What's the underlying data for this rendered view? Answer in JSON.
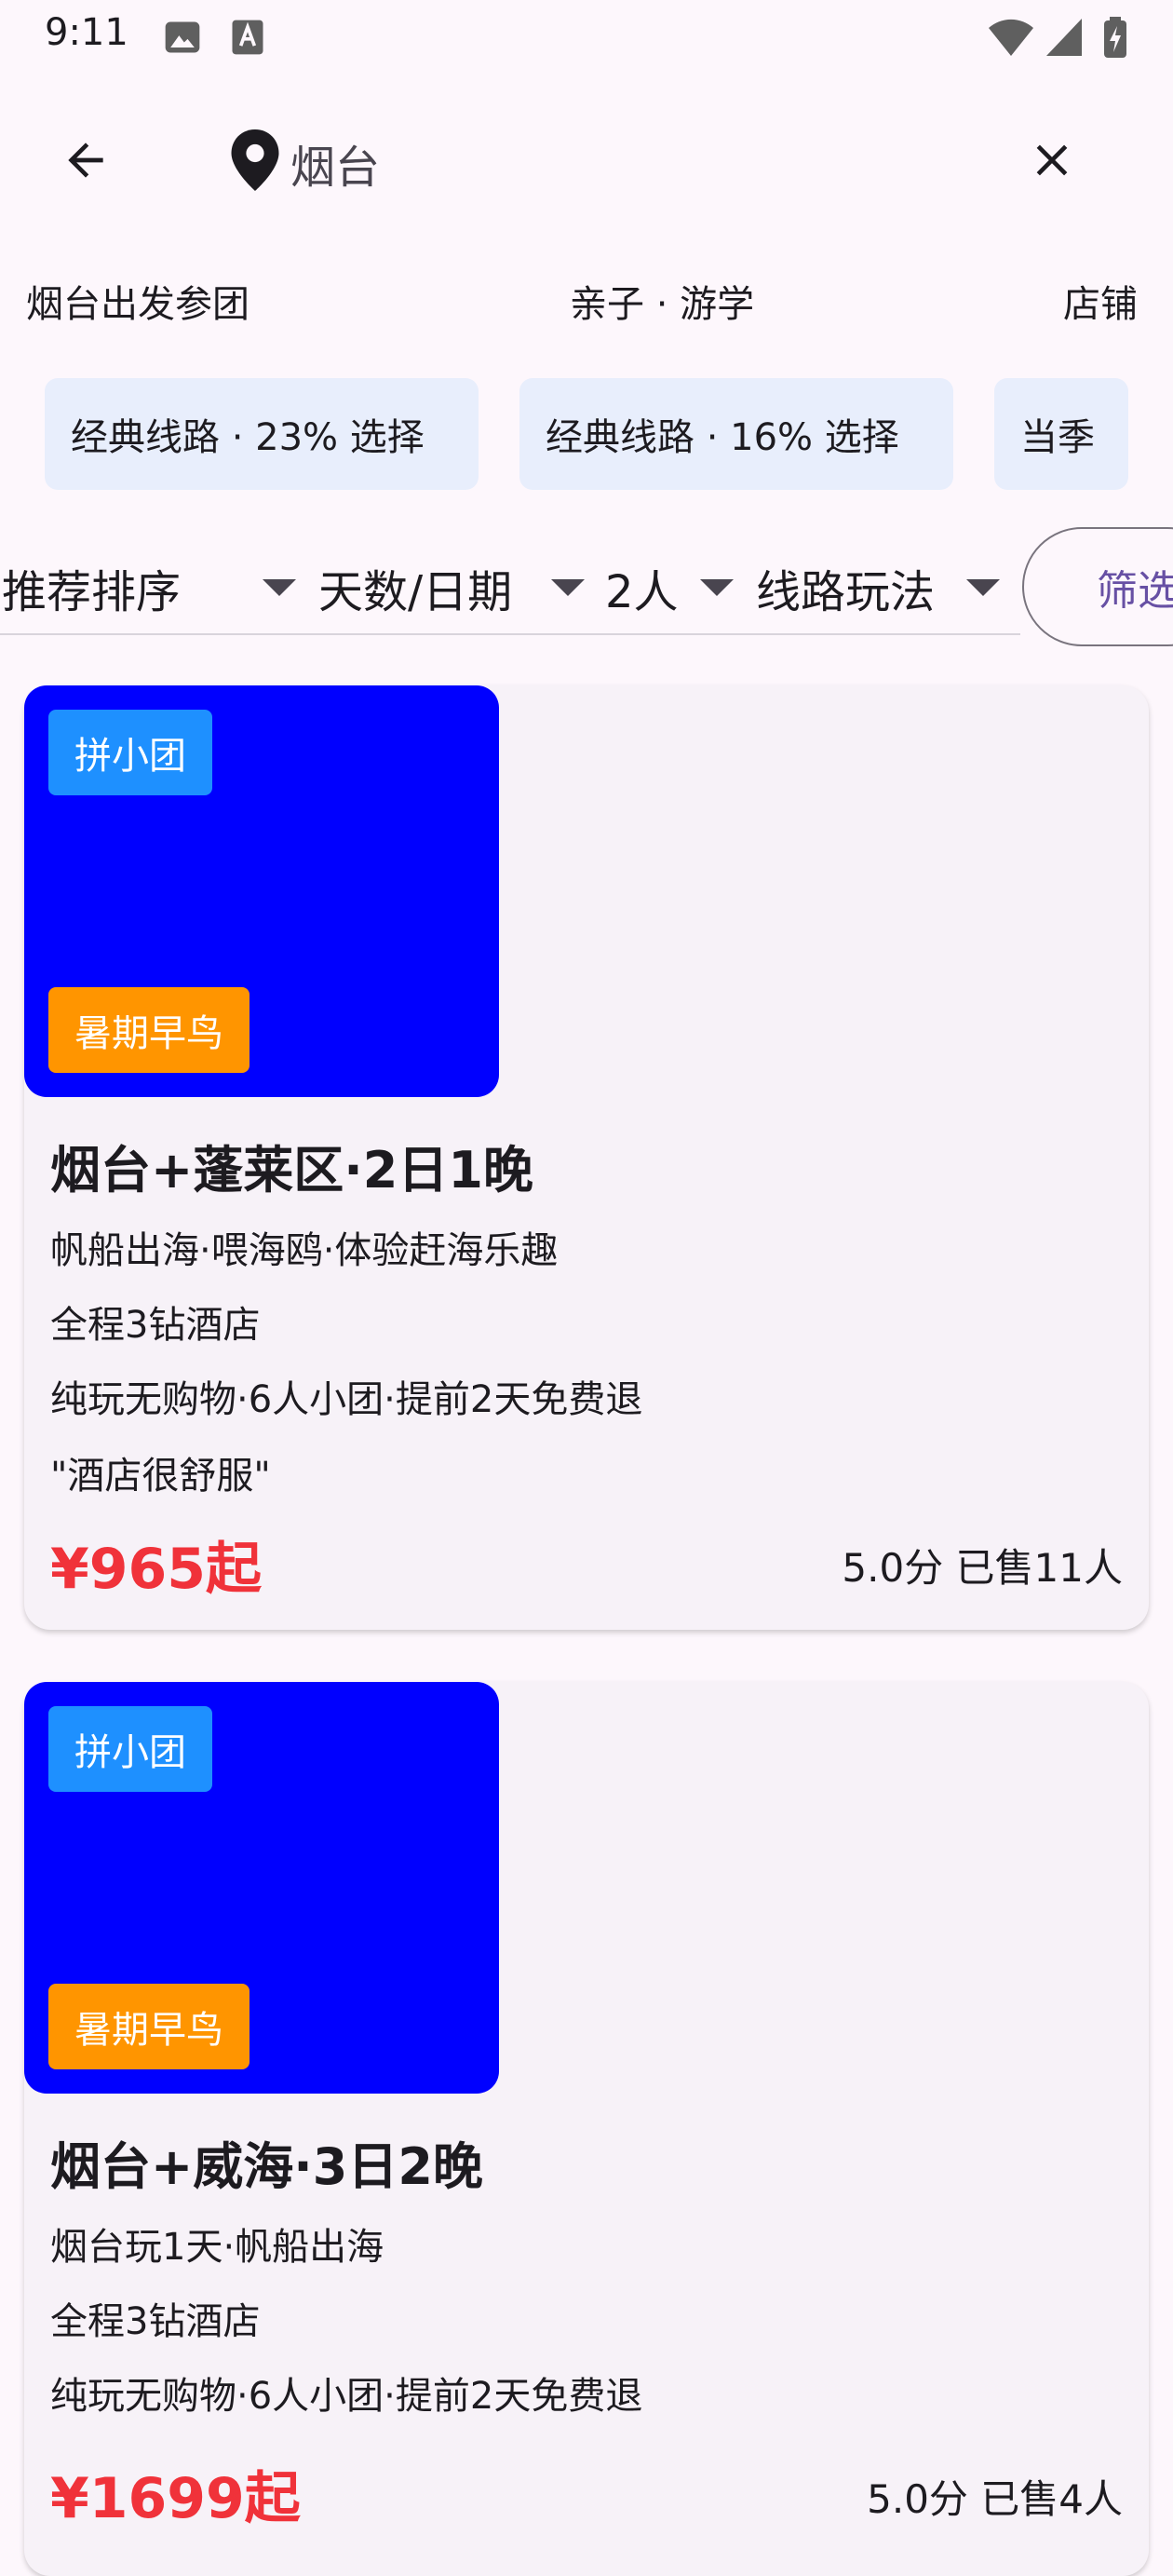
{
  "status_bar": {
    "time": "9:11"
  },
  "search": {
    "query": "烟台"
  },
  "category_tabs": [
    {
      "label": "烟台出发参团"
    },
    {
      "label": "亲子 · 游学"
    },
    {
      "label": "店铺"
    }
  ],
  "chips": [
    {
      "label": "经典线路 · 23% 选择"
    },
    {
      "label": "经典线路 · 16% 选择"
    },
    {
      "label": "当季"
    }
  ],
  "filters": {
    "sort": "推荐排序",
    "days": "天数/日期",
    "people": "2人",
    "routes": "线路玩法",
    "filter_button": "筛选"
  },
  "products": [
    {
      "badge_top": "拼小团",
      "badge_bottom": "暑期早鸟",
      "title": "烟台+蓬莱区·2日1晚",
      "line1": "帆船出海·喂海鸥·体验赶海乐趣",
      "line2": "全程3钻酒店",
      "line3": "纯玩无购物·6人小团·提前2天免费退",
      "review": "\"酒店很舒服\"",
      "price": "¥965起",
      "meta": "5.0分 已售11人"
    },
    {
      "badge_top": "拼小团",
      "badge_bottom": "暑期早鸟",
      "title": "烟台+威海·3日2晚",
      "line1": "烟台玩1天·帆船出海",
      "line2": "全程3钻酒店",
      "line3": "纯玩无购物·6人小团·提前2天免费退",
      "price": "¥1699起",
      "meta": "5.0分 已售4人"
    }
  ],
  "colors": {
    "price": "#f0323a",
    "badge_group": "#1e90ff",
    "badge_early": "#ff9500",
    "image_placeholder": "#0000ff",
    "chip_bg": "#e8eefc",
    "accent": "#6750a4"
  },
  "icons": [
    "image-icon",
    "text-icon",
    "wifi-icon",
    "signal-icon",
    "battery-icon",
    "back-arrow-icon",
    "location-pin-icon",
    "close-icon",
    "caret-down-icon"
  ]
}
